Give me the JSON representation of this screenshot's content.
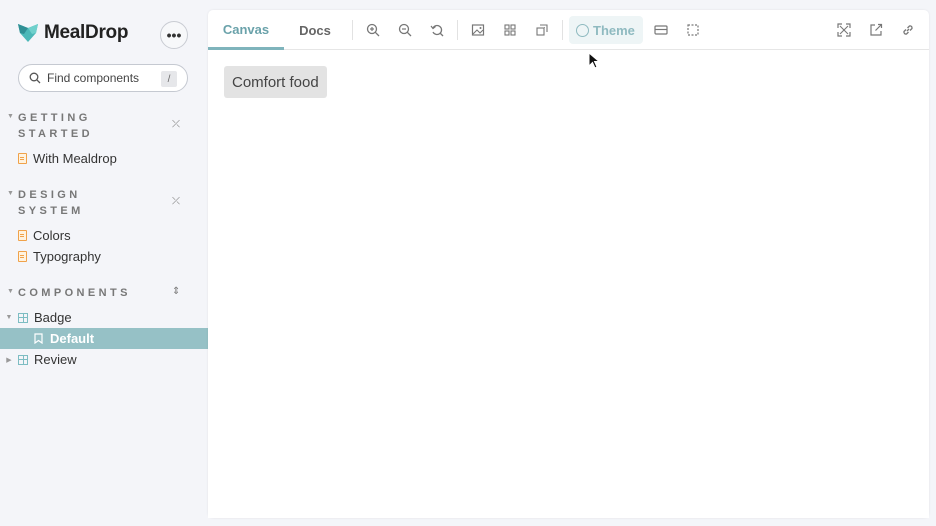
{
  "brand": {
    "name": "MealDrop",
    "logo_icon": "fox-logo-icon",
    "accent": "#4cb8b8"
  },
  "sidebar": {
    "menu_label": "•••",
    "search": {
      "placeholder": "Find components",
      "shortcut": "/"
    },
    "sections": [
      {
        "title": "GETTING STARTED",
        "items": [
          {
            "label": "With Mealdrop",
            "icon": "document-icon"
          }
        ]
      },
      {
        "title": "DESIGN SYSTEM",
        "items": [
          {
            "label": "Colors",
            "icon": "document-icon"
          },
          {
            "label": "Typography",
            "icon": "document-icon"
          }
        ]
      },
      {
        "title": "COMPONENTS",
        "items": [
          {
            "label": "Badge",
            "icon": "component-icon",
            "expanded": true,
            "children": [
              {
                "label": "Default",
                "icon": "bookmark-icon",
                "selected": true
              }
            ]
          },
          {
            "label": "Review",
            "icon": "component-icon",
            "expanded": false
          }
        ]
      }
    ]
  },
  "toolbar": {
    "tabs": [
      {
        "label": "Canvas",
        "active": true
      },
      {
        "label": "Docs",
        "active": false
      }
    ],
    "theme_label": "Theme",
    "icons": [
      "zoom-in-icon",
      "zoom-out-icon",
      "zoom-reset-icon",
      "background-icon",
      "grid-icon",
      "measure-icon",
      "theme-icon",
      "viewport-icon",
      "outline-icon",
      "fullscreen-icon",
      "open-new-tab-icon",
      "copy-link-icon"
    ]
  },
  "canvas": {
    "badge_text": "Comfort food"
  },
  "colors": {
    "selected_bg": "#96c1c6",
    "active_tab": "#6aa2aa",
    "doc_icon": "#f0a24a"
  }
}
